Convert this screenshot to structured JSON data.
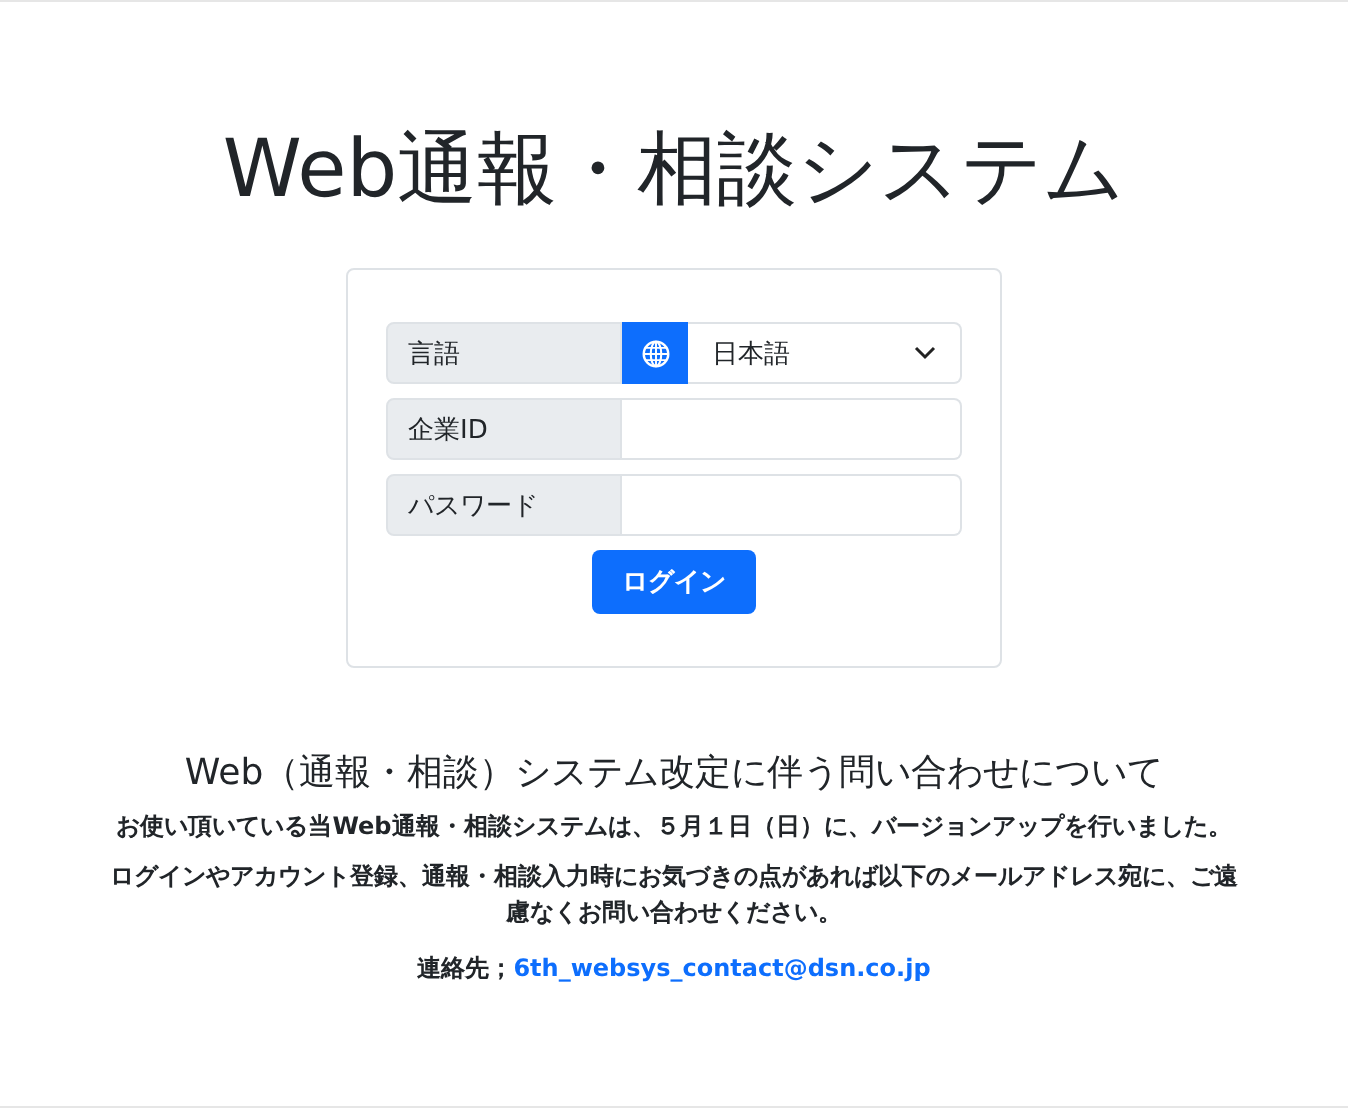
{
  "title": "Web通報・相談システム",
  "form": {
    "language": {
      "label": "言語",
      "value": "日本語"
    },
    "company_id": {
      "label": "企業ID"
    },
    "password": {
      "label": "パスワード"
    },
    "login_button": "ログイン"
  },
  "notice": {
    "heading": "Web（通報・相談）システム改定に伴う問い合わせについて",
    "paragraphs": [
      "お使い頂いている当Web通報・相談システムは、５月１日（日）に、バージョンアップを行いました。",
      "ログインやアカウント登録、通報・相談入力時にお気づきの点があれば以下のメールアドレス宛に、ご遠慮なくお問い合わせください。"
    ],
    "contact_label": "連絡先；",
    "contact_email": "6th_websys_contact@dsn.co.jp"
  }
}
